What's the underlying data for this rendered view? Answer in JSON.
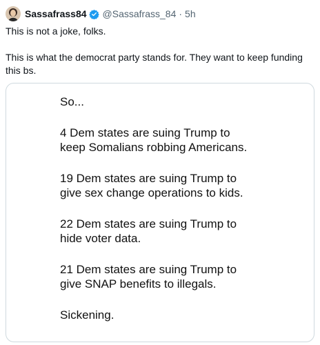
{
  "author": {
    "display_name": "Sassafrass84",
    "handle": "@Sassafrass_84",
    "separator": "·",
    "time": "5h",
    "verified_color": "#1d9bf0"
  },
  "tweet": {
    "line1": "This is not a joke, folks.",
    "line2": "This is what the democrat party stands for. They want to keep funding this bs."
  },
  "image": {
    "lines": [
      "So...",
      "4 Dem states are suing Trump to",
      "keep Somalians robbing Americans.",
      "19 Dem states are suing Trump to",
      "give sex change operations to kids.",
      "22 Dem states are suing Trump to",
      "hide voter data.",
      "21 Dem states are suing Trump to",
      "give SNAP benefits to illegals.",
      "Sickening."
    ]
  }
}
